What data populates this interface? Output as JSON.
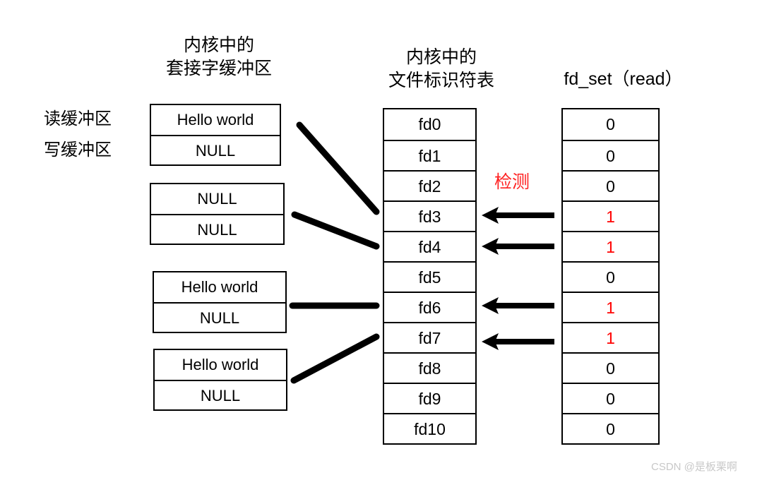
{
  "headings": {
    "socket_buffer": "内核中的\n套接字缓冲区",
    "fd_table": "内核中的\n文件标识符表",
    "fd_set": "fd_set（read）"
  },
  "side_labels": {
    "read_buffer": "读缓冲区",
    "write_buffer": "写缓冲区"
  },
  "socket_boxes": [
    {
      "read": "Hello world",
      "write": "NULL"
    },
    {
      "read": "NULL",
      "write": "NULL"
    },
    {
      "read": "Hello world",
      "write": "NULL"
    },
    {
      "read": "Hello world",
      "write": "NULL"
    }
  ],
  "fd_table": {
    "rows": [
      "fd0",
      "fd1",
      "fd2",
      "fd3",
      "fd4",
      "fd5",
      "fd6",
      "fd7",
      "fd8",
      "fd9",
      "fd10"
    ]
  },
  "fd_set": {
    "bits": [
      "0",
      "0",
      "0",
      "1",
      "1",
      "0",
      "1",
      "1",
      "0",
      "0",
      "0"
    ],
    "set_indices": [
      3,
      4,
      6,
      7
    ]
  },
  "annotation": {
    "detect": "检测"
  },
  "watermark": "CSDN @是板栗啊",
  "colors": {
    "set_bit": "#ff0000",
    "annotation": "#ff2020",
    "line": "#000000",
    "watermark": "#c8c8c8",
    "background": "#ffffff"
  }
}
